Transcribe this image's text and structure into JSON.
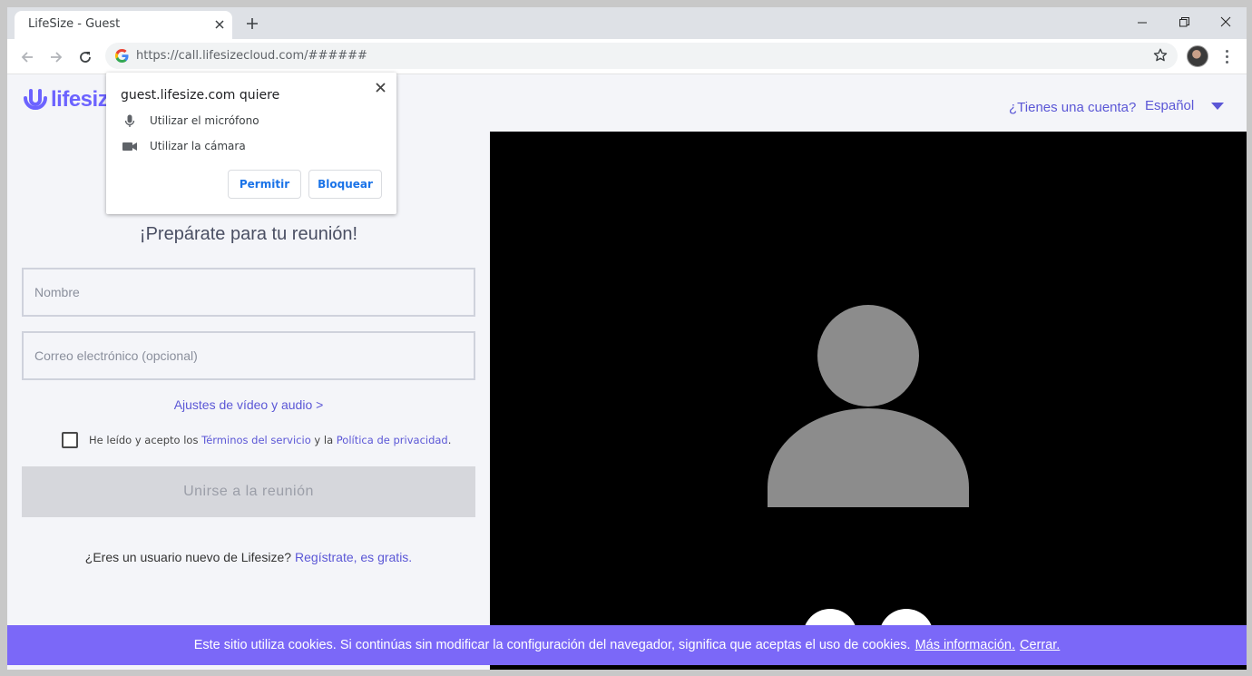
{
  "browser": {
    "tab_title": "LifeSize - Guest",
    "url": "https://call.lifesizecloud.com/######"
  },
  "header": {
    "logo_text": "lifesiz",
    "account_link": "¿Tienes una cuenta?",
    "language": "Español"
  },
  "permission_popup": {
    "title": "guest.lifesize.com quiere",
    "microphone": "Utilizar el micrófono",
    "camera": "Utilizar la cámara",
    "allow": "Permitir",
    "block": "Bloquear"
  },
  "form": {
    "heading": "¡Prepárate para tu reunión!",
    "name_placeholder": "Nombre",
    "email_placeholder": "Correo electrónico (opcional)",
    "settings_link": "Ajustes de vídeo y audio >",
    "terms_prefix": "He leído y acepto los",
    "terms_link": "Términos del servicio",
    "terms_middle": "y la",
    "privacy_link": "Política de privacidad",
    "terms_suffix": ".",
    "join_button": "Unirse a la reunión",
    "new_user_text": "¿Eres un usuario nuevo de Lifesize?",
    "register_link": "Regístrate, es gratis."
  },
  "cookie_banner": {
    "text": "Este sitio utiliza cookies. Si continúas sin modificar la configuración del navegador, significa que aceptas el uso de cookies.",
    "more_info": "Más información.",
    "close": "Cerrar."
  },
  "colors": {
    "brand": "#6c63ff",
    "link": "#5b57d6",
    "cookie_bg": "#7b68f8",
    "muted_red": "#e0443c"
  }
}
